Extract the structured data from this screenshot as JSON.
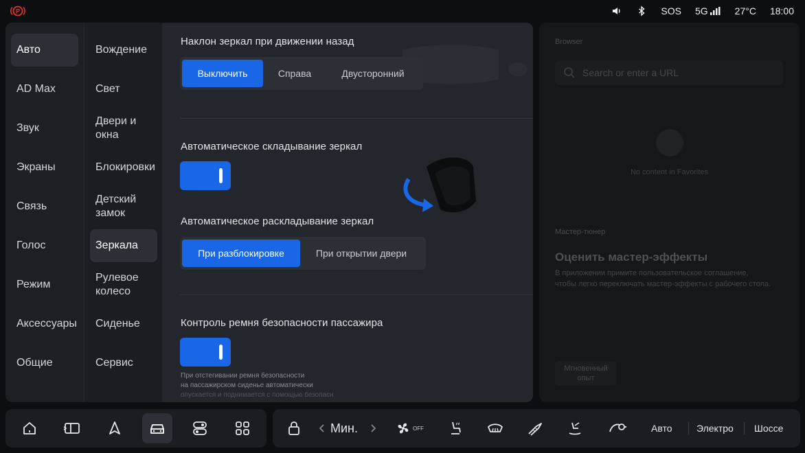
{
  "status": {
    "sos": "SOS",
    "network": "5G",
    "temperature": "27°C",
    "time": "18:00",
    "left_icon": "parking-brake-warning-icon",
    "warning_color": "#e0352b"
  },
  "menu_primary": [
    {
      "label": "Авто",
      "active": true
    },
    {
      "label": "AD Max",
      "active": false
    },
    {
      "label": "Звук",
      "active": false
    },
    {
      "label": "Экраны",
      "active": false
    },
    {
      "label": "Связь",
      "active": false
    },
    {
      "label": "Голос",
      "active": false
    },
    {
      "label": "Режим",
      "active": false
    },
    {
      "label": "Аксессуары",
      "active": false
    },
    {
      "label": "Общие",
      "active": false
    }
  ],
  "menu_secondary": [
    {
      "label": "Вождение",
      "active": false
    },
    {
      "label": "Свет",
      "active": false
    },
    {
      "label": "Двери и окна",
      "active": false
    },
    {
      "label": "Блокировки",
      "active": false
    },
    {
      "label": "Детский замок",
      "active": false
    },
    {
      "label": "Зеркала",
      "active": true
    },
    {
      "label": "Рулевое колесо",
      "active": false
    },
    {
      "label": "Сиденье",
      "active": false
    },
    {
      "label": "Сервис",
      "active": false
    }
  ],
  "mirrors": {
    "reverse_tilt": {
      "title": "Наклон зеркал при движении назад",
      "options": [
        "Выключить",
        "Справа",
        "Двусторонний"
      ],
      "selected": "Выключить"
    },
    "auto_fold": {
      "title": "Автоматическое складывание зеркал",
      "enabled": true
    },
    "auto_unfold": {
      "title": "Автоматическое раскладывание зеркал",
      "options": [
        "При разблокировке",
        "При открытии двери"
      ],
      "selected": "При разблокировке"
    },
    "seatbelt": {
      "title": "Контроль ремня безопасности пассажира",
      "enabled": true,
      "note_lines": [
        "При отстегивании ремня безопасности",
        "на пассажирском сиденье автоматически",
        "опускается и поднимается с помощью безопасн"
      ]
    }
  },
  "browser_panel": {
    "label": "Browser",
    "search_placeholder": "Search or enter a URL",
    "empty_text": "No content in Favorites",
    "section_label": "Мастер-тюнер",
    "title": "Оценить мастер-эффекты",
    "description_lines": [
      "В приложении примите пользовательское соглашение,",
      "чтобы легко переключать мастер-эффекты с рабочего стола."
    ],
    "button_lines": [
      "Мгновенный",
      "опыт"
    ]
  },
  "dock": {
    "apps": [
      "home-icon",
      "card-icon",
      "navigation-icon",
      "car-icon",
      "toggle-icon",
      "apps-grid-icon"
    ],
    "active_app": "car-icon",
    "fan_speed": "Мин.",
    "fan_state": "OFF",
    "drive_modes": [
      "Авто",
      "Электро",
      "Шоссе"
    ],
    "accent_color": "#1967e6"
  }
}
